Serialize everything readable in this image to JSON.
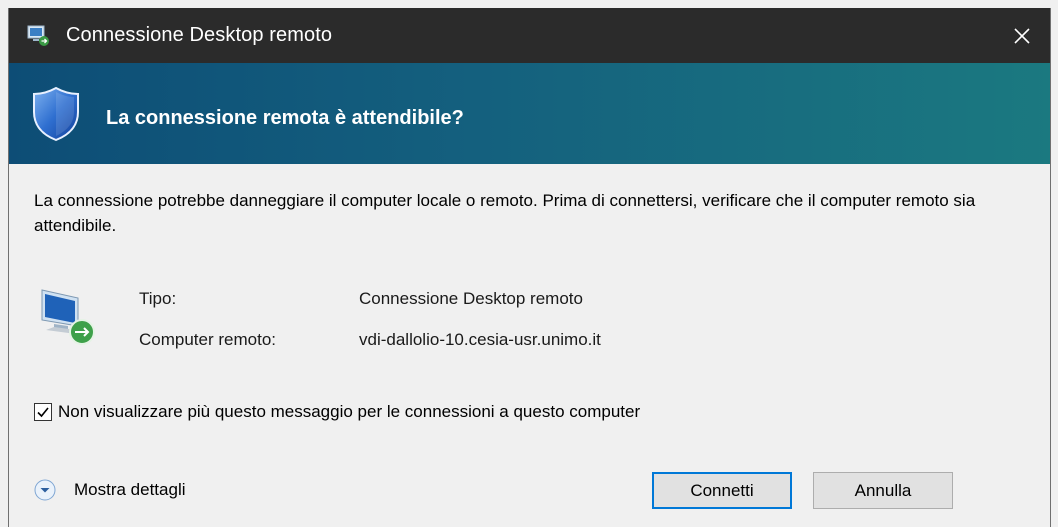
{
  "window": {
    "title": "Connessione Desktop remoto"
  },
  "banner": {
    "heading": "La connessione remota è attendibile?"
  },
  "message": "La connessione potrebbe danneggiare il computer locale o remoto. Prima di connettersi, verificare che il computer remoto sia attendibile.",
  "details_table": [
    {
      "label": "Tipo:",
      "value": "Connessione Desktop remoto"
    },
    {
      "label": "Computer remoto:",
      "value": "vdi-dallolio-10.cesia-usr.unimo.it"
    }
  ],
  "checkbox": {
    "label": "Non visualizzare più questo messaggio per le connessioni a questo computer",
    "checked": true
  },
  "footer": {
    "details_toggle": "Mostra dettagli",
    "connect_label": "Connetti",
    "cancel_label": "Annulla"
  },
  "colors": {
    "titlebar": "#2b2b2b",
    "banner_start": "#0d4d76",
    "banner_end": "#1b7980",
    "accent": "#0078d7"
  }
}
